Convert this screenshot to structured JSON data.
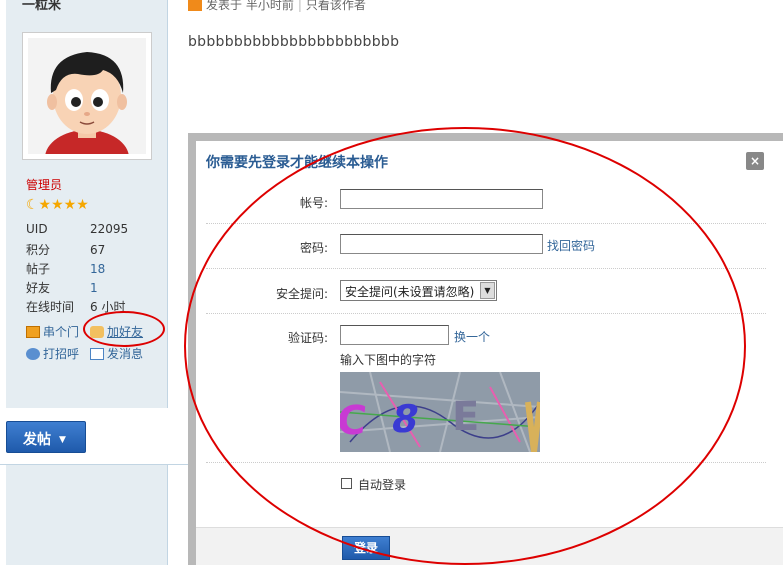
{
  "profile": {
    "username": "一粒米",
    "role": "管理员",
    "stars": "☾★★★★",
    "stats": [
      {
        "key": "UID",
        "value": "22095"
      },
      {
        "key": "积分",
        "value": "67"
      },
      {
        "key": "帖子",
        "value": "18"
      },
      {
        "key": "好友",
        "value": "1"
      },
      {
        "key": "在线时间",
        "value": "6 小时"
      }
    ],
    "actions": {
      "visit": "串个门",
      "add_friend": "加好友",
      "greet": "打招呼",
      "message": "发消息"
    }
  },
  "post": {
    "meta_posted": "发表于 半小时前",
    "meta_author_only": "只看该作者",
    "body": "bbbbbbbbbbbbbbbbbbbbbbb"
  },
  "post_button": {
    "label": "发帖",
    "caret": "▼"
  },
  "login_dialog": {
    "title": "你需要先登录才能继续本操作",
    "close": "×",
    "account_label": "帐号:",
    "account_value": "",
    "password_label": "密码:",
    "password_value": "",
    "recover_password": "找回密码",
    "security_label": "安全提问:",
    "security_selected": "安全提问(未设置请忽略)",
    "captcha_label": "验证码:",
    "captcha_value": "",
    "captcha_refresh": "换一个",
    "captcha_hint": "输入下图中的字符",
    "captcha_text": "C8E",
    "auto_login": "自动登录",
    "submit": "登录"
  },
  "colors": {
    "annotation_red": "#dd0000",
    "link_blue": "#336699",
    "button_blue": "#2f6cc2"
  }
}
